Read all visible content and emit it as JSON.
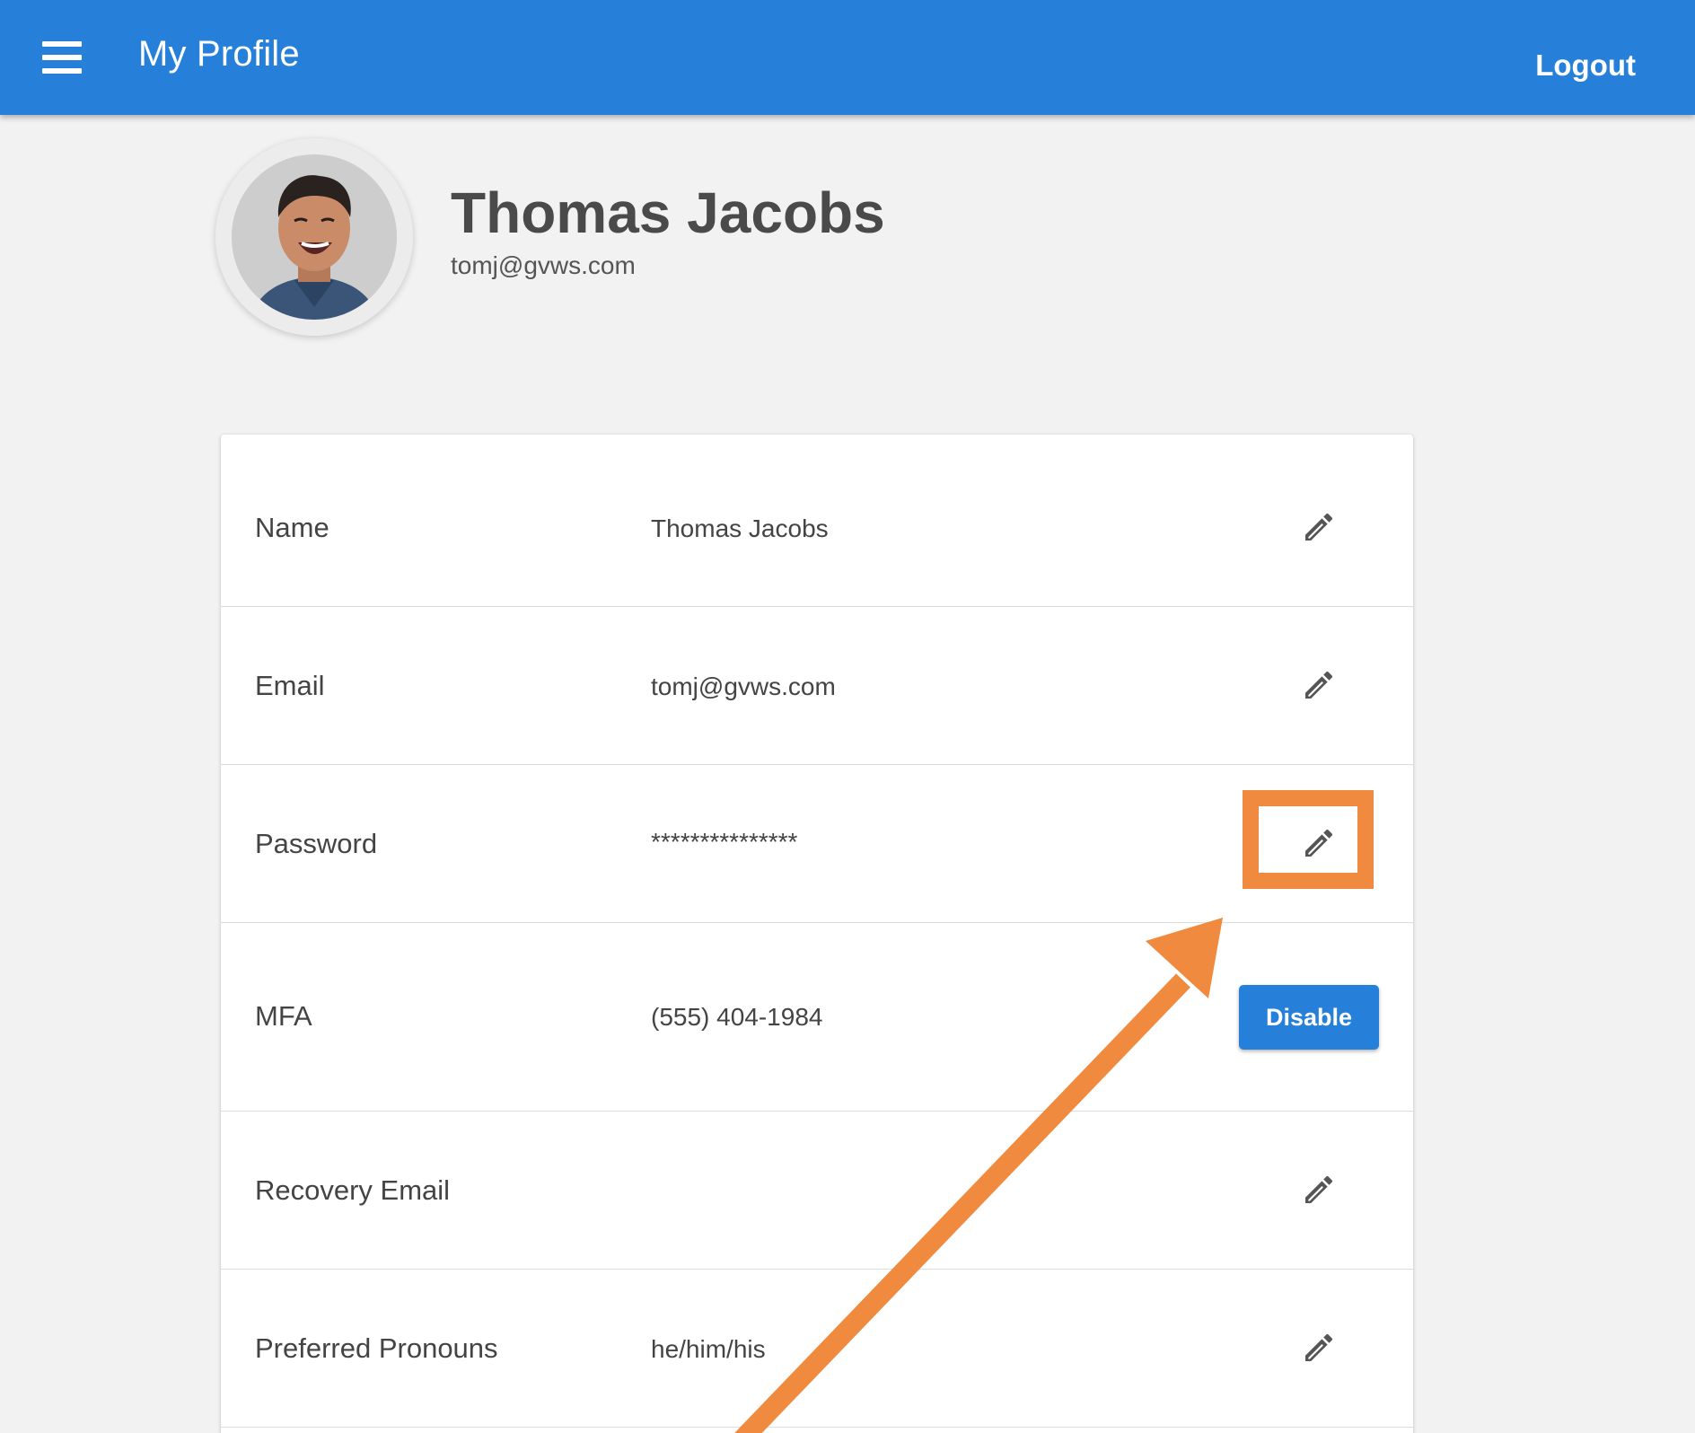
{
  "header": {
    "title": "My Profile",
    "logout_label": "Logout"
  },
  "profile": {
    "name": "Thomas Jacobs",
    "email": "tomj@gvws.com"
  },
  "rows": [
    {
      "label": "Name",
      "value": "Thomas Jacobs",
      "action": "edit"
    },
    {
      "label": "Email",
      "value": "tomj@gvws.com",
      "action": "edit"
    },
    {
      "label": "Password",
      "value": "***************",
      "action": "edit",
      "highlighted": true
    },
    {
      "label": "MFA",
      "value": "(555) 404-1984",
      "action": "button",
      "button_label": "Disable"
    },
    {
      "label": "Recovery Email",
      "value": "",
      "action": "edit"
    },
    {
      "label": "Preferred Pronouns",
      "value": "he/him/his",
      "action": "edit"
    }
  ],
  "colors": {
    "primary": "#2680d9",
    "annotation": "#ef8a3e",
    "background": "#f2f2f2"
  },
  "icons": {
    "menu": "hamburger-menu-icon",
    "edit": "pencil-icon"
  }
}
